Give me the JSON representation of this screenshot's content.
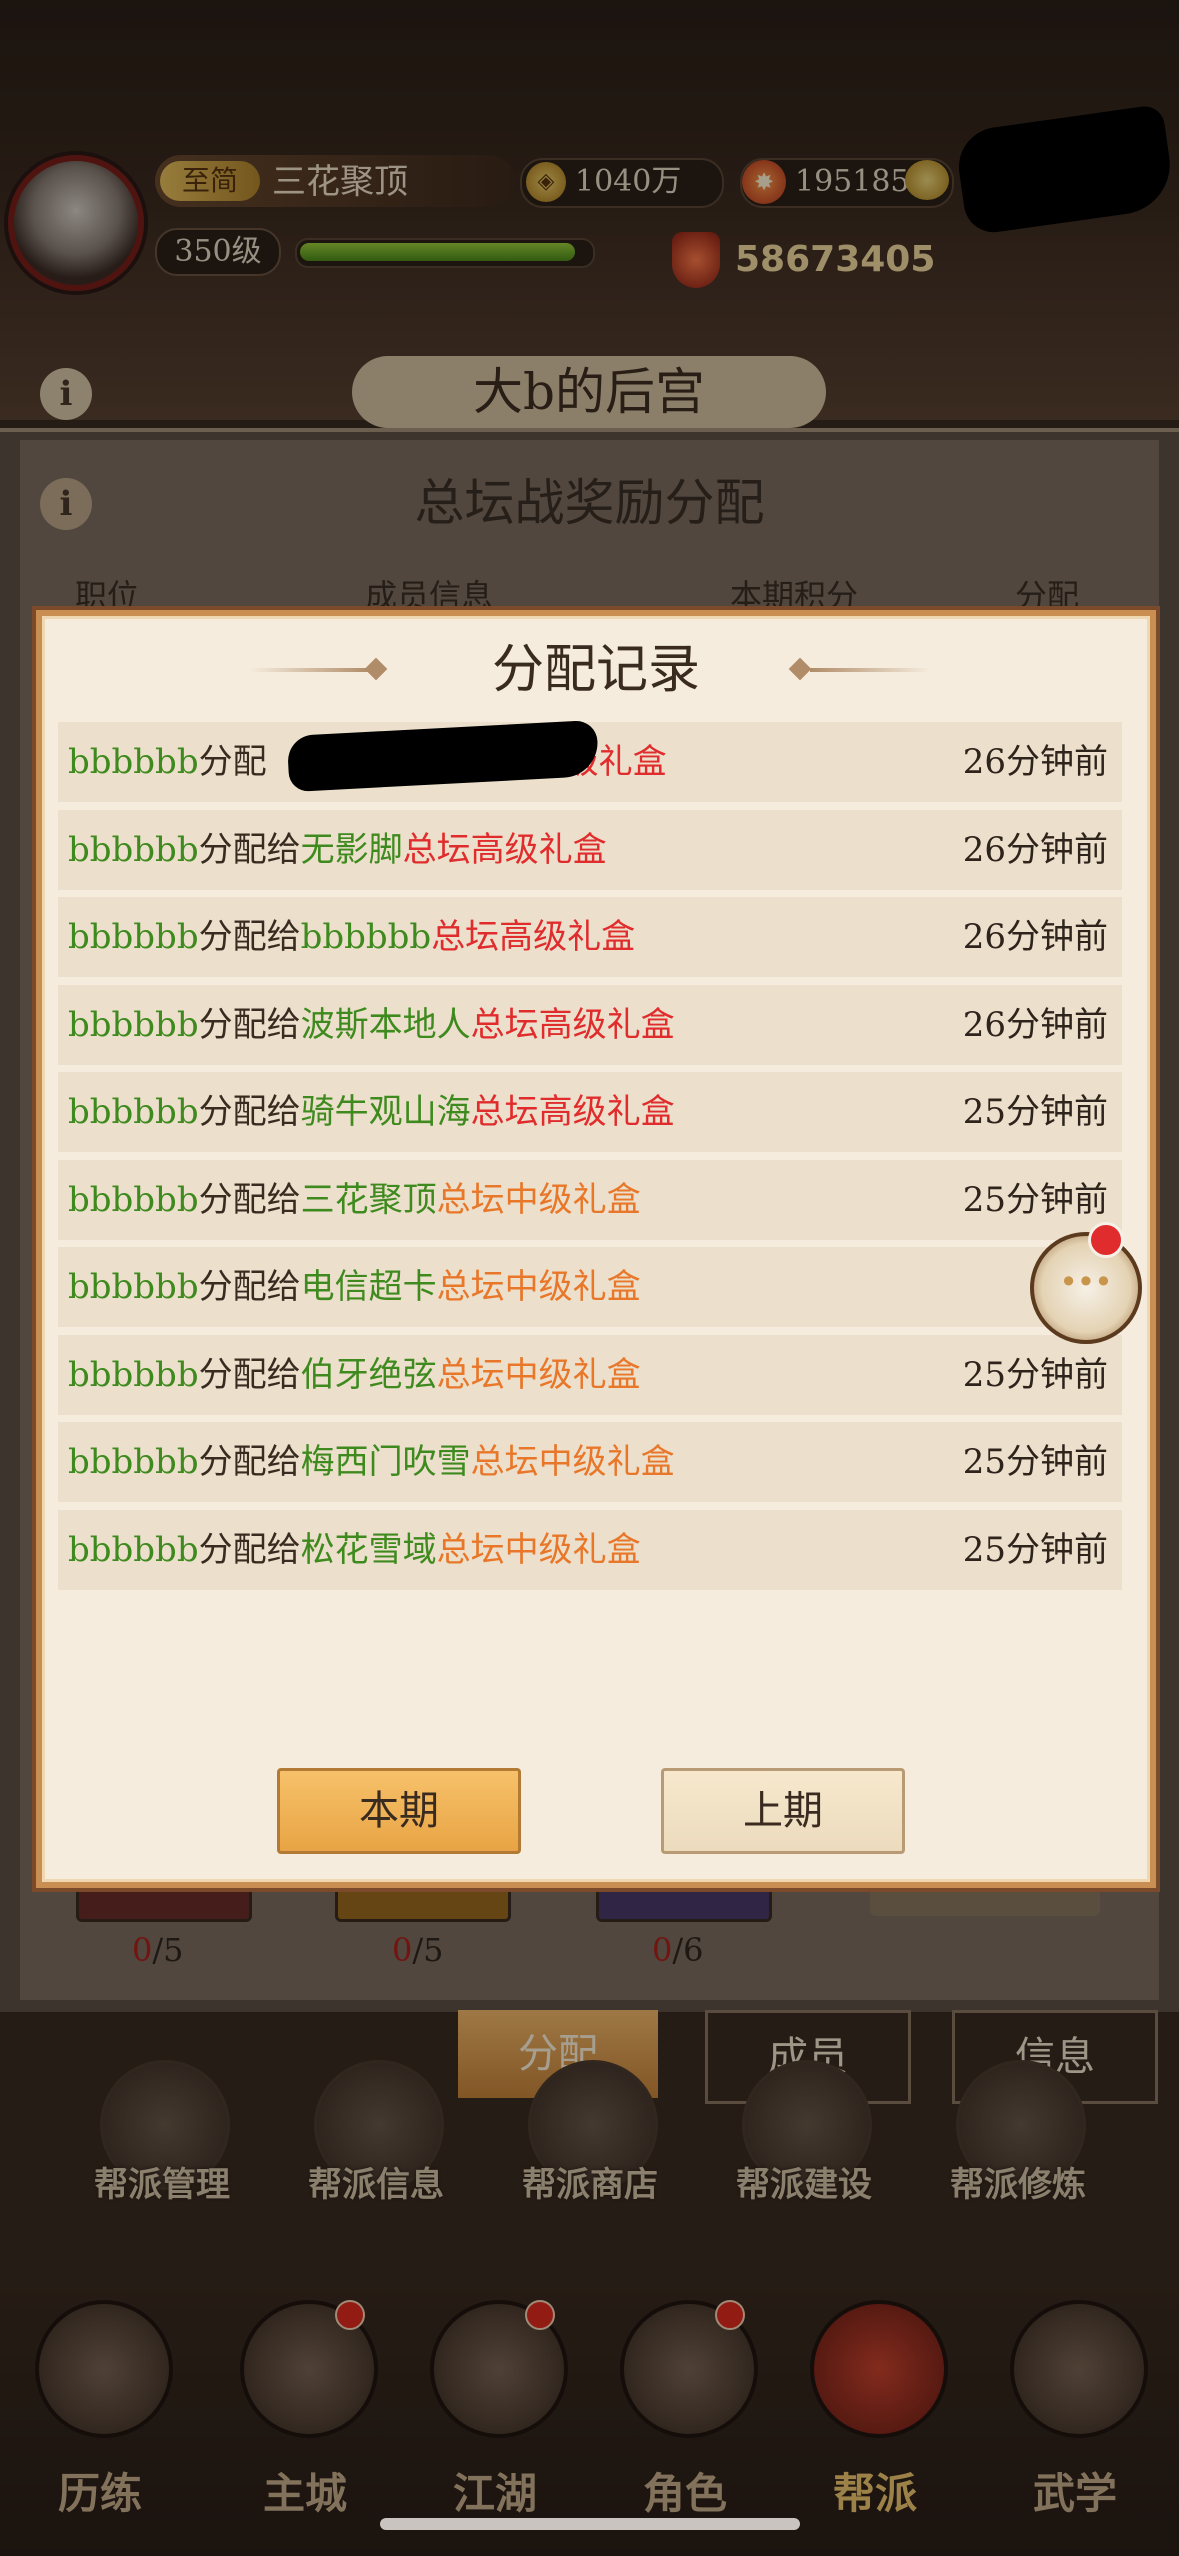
{
  "hud": {
    "badge": "至简",
    "player_name": "三花聚顶",
    "level": "350级",
    "coins": "1040万",
    "coin_icon_glyph": "◈",
    "jade": "195185",
    "jade_icon_glyph": "✸",
    "power": "58673405",
    "exp_fraction": 0.96
  },
  "guild_title": "大b的后宫",
  "info_glyph": "i",
  "panel": {
    "title": "总坛战奖励分配",
    "columns": [
      "职位",
      "成员信息",
      "本期积分",
      "分配"
    ],
    "slots": [
      {
        "have": "0",
        "total": "/5",
        "color": "#6a2f2a"
      },
      {
        "have": "0",
        "total": "/5",
        "color": "#9a6a1e"
      },
      {
        "have": "0",
        "total": "/6",
        "color": "#4a3a6a"
      }
    ]
  },
  "modal": {
    "title": "分配记录",
    "rows": [
      {
        "giver": "bbbbbb",
        "verb": "分配",
        "recipient": "",
        "gift": "坛高级礼盒",
        "gift_tier": "high",
        "time": "26分钟前",
        "redacted": true
      },
      {
        "giver": "bbbbbb",
        "verb": "分配给",
        "recipient": "无影脚",
        "gift": "总坛高级礼盒",
        "gift_tier": "high",
        "time": "26分钟前"
      },
      {
        "giver": "bbbbbb",
        "verb": "分配给",
        "recipient": "bbbbbb",
        "gift": "总坛高级礼盒",
        "gift_tier": "high",
        "time": "26分钟前"
      },
      {
        "giver": "bbbbbb",
        "verb": "分配给",
        "recipient": "波斯本地人",
        "gift": "总坛高级礼盒",
        "gift_tier": "high",
        "time": "26分钟前"
      },
      {
        "giver": "bbbbbb",
        "verb": "分配给",
        "recipient": "骑牛观山海",
        "gift": "总坛高级礼盒",
        "gift_tier": "high",
        "time": "25分钟前"
      },
      {
        "giver": "bbbbbb",
        "verb": "分配给",
        "recipient": "三花聚顶",
        "gift": "总坛中级礼盒",
        "gift_tier": "mid",
        "time": "25分钟前"
      },
      {
        "giver": "bbbbbb",
        "verb": "分配给",
        "recipient": "电信超卡",
        "gift": "总坛中级礼盒",
        "gift_tier": "mid",
        "time": "25分"
      },
      {
        "giver": "bbbbbb",
        "verb": "分配给",
        "recipient": "伯牙绝弦",
        "gift": "总坛中级礼盒",
        "gift_tier": "mid",
        "time": "25分钟前"
      },
      {
        "giver": "bbbbbb",
        "verb": "分配给",
        "recipient": "梅西门吹雪",
        "gift": "总坛中级礼盒",
        "gift_tier": "mid",
        "time": "25分钟前"
      },
      {
        "giver": "bbbbbb",
        "verb": "分配给",
        "recipient": "松花雪域",
        "gift": "总坛中级礼盒",
        "gift_tier": "mid",
        "time": "25分钟前"
      }
    ],
    "btn_current": "本期",
    "btn_previous": "上期"
  },
  "chat_glyph": "···",
  "tabs": {
    "distribute": "分配",
    "members": "成员",
    "info": "信息"
  },
  "actions": [
    {
      "label": "帮派管理",
      "icon": "gear-gate-icon"
    },
    {
      "label": "帮派信息",
      "icon": "pavilion-icon"
    },
    {
      "label": "帮派商店",
      "icon": "shop-icon"
    },
    {
      "label": "帮派建设",
      "icon": "hammer-icon"
    },
    {
      "label": "帮派修炼",
      "icon": "lotus-icon"
    }
  ],
  "nav": [
    {
      "label": "历练",
      "dot": false
    },
    {
      "label": "主城",
      "dot": true
    },
    {
      "label": "江湖",
      "dot": true
    },
    {
      "label": "角色",
      "dot": true
    },
    {
      "label": "帮派",
      "dot": false
    },
    {
      "label": "武学",
      "dot": false
    }
  ],
  "colors": {
    "green": "#3f8a1f",
    "red": "#e02c2c",
    "orange": "#e8772a",
    "accent": "#e8a444"
  }
}
